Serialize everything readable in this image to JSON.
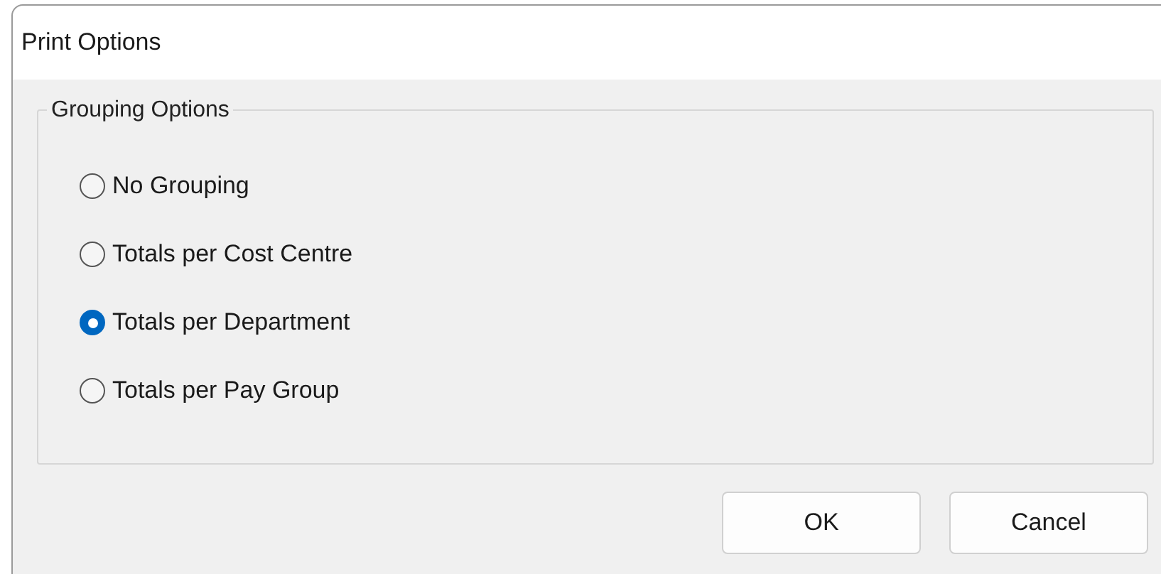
{
  "window": {
    "title": "Print Options"
  },
  "group": {
    "label": "Grouping Options",
    "options": [
      {
        "label": "No Grouping",
        "selected": false
      },
      {
        "label": "Totals per Cost Centre",
        "selected": false
      },
      {
        "label": "Totals per Department",
        "selected": true
      },
      {
        "label": "Totals per Pay Group",
        "selected": false
      }
    ]
  },
  "buttons": [
    "OK",
    "Cancel"
  ]
}
